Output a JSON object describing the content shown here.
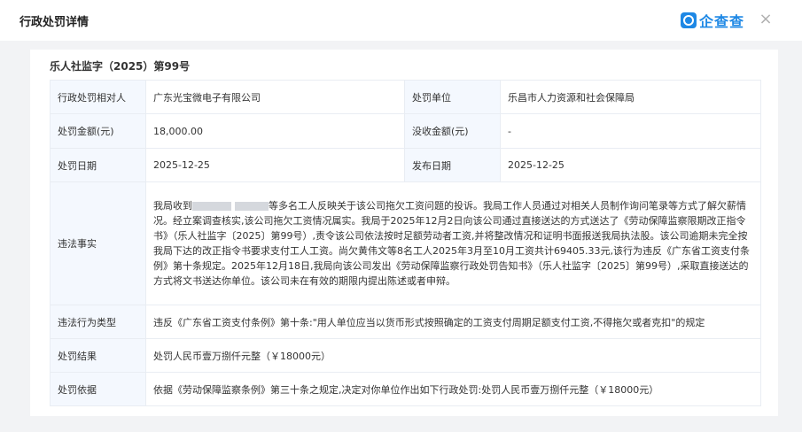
{
  "header": {
    "title": "行政处罚详情",
    "logo_text": "企查查",
    "close_symbol": "×",
    "brand_color": "#1e88e5"
  },
  "document": {
    "number": "乐人社监字（2025）第99号"
  },
  "rows": {
    "party_label": "行政处罚相对人",
    "party_value": "广东光宝微电子有限公司",
    "unit_label": "处罚单位",
    "unit_value": "乐昌市人力资源和社会保障局",
    "amount_label": "处罚金额(元)",
    "amount_value": "18,000.00",
    "confiscation_label": "没收金额(元)",
    "confiscation_value": "-",
    "date_label": "处罚日期",
    "date_value": "2025-12-25",
    "publish_label": "发布日期",
    "publish_value": "2025-12-25",
    "facts_label": "违法事实",
    "facts_prefix": "我局收到",
    "facts_body": "等多名工人反映关于该公司拖欠工资问题的投诉。我局工作人员通过对相关人员制作询问笔录等方式了解欠薪情况。经立案调查核实,该公司拖欠工资情况属实。我局于2025年12月2日向该公司通过直接送达的方式送达了《劳动保障监察限期改正指令书》（乐人社监字〔2025〕第99号）,责令该公司依法按时足额劳动者工资,并将整改情况和证明书面报送我局执法股。该公司逾期未完全按我局下达的改正指令书要求支付工人工资。尚欠黄伟文等8名工人2025年3月至10月工资共计69405.33元,该行为违反《广东省工资支付条例》第十条规定。2025年12月18日,我局向该公司发出《劳动保障监察行政处罚告知书》（乐人社监字〔2025〕第99号）,采取直接送达的方式将文书送达你单位。该公司未在有效的期限内提出陈述或者申辩。",
    "type_label": "违法行为类型",
    "type_value": "违反《广东省工资支付条例》第十条:\"用人单位应当以货币形式按照确定的工资支付周期足额支付工资,不得拖欠或者克扣\"的规定",
    "result_label": "处罚结果",
    "result_value": "处罚人民币壹万捌仟元整（￥18000元）",
    "basis_label": "处罚依据",
    "basis_value": "依据《劳动保障监察条例》第三十条之规定,决定对你单位作出如下行政处罚:处罚人民币壹万捌仟元整（￥18000元）"
  }
}
